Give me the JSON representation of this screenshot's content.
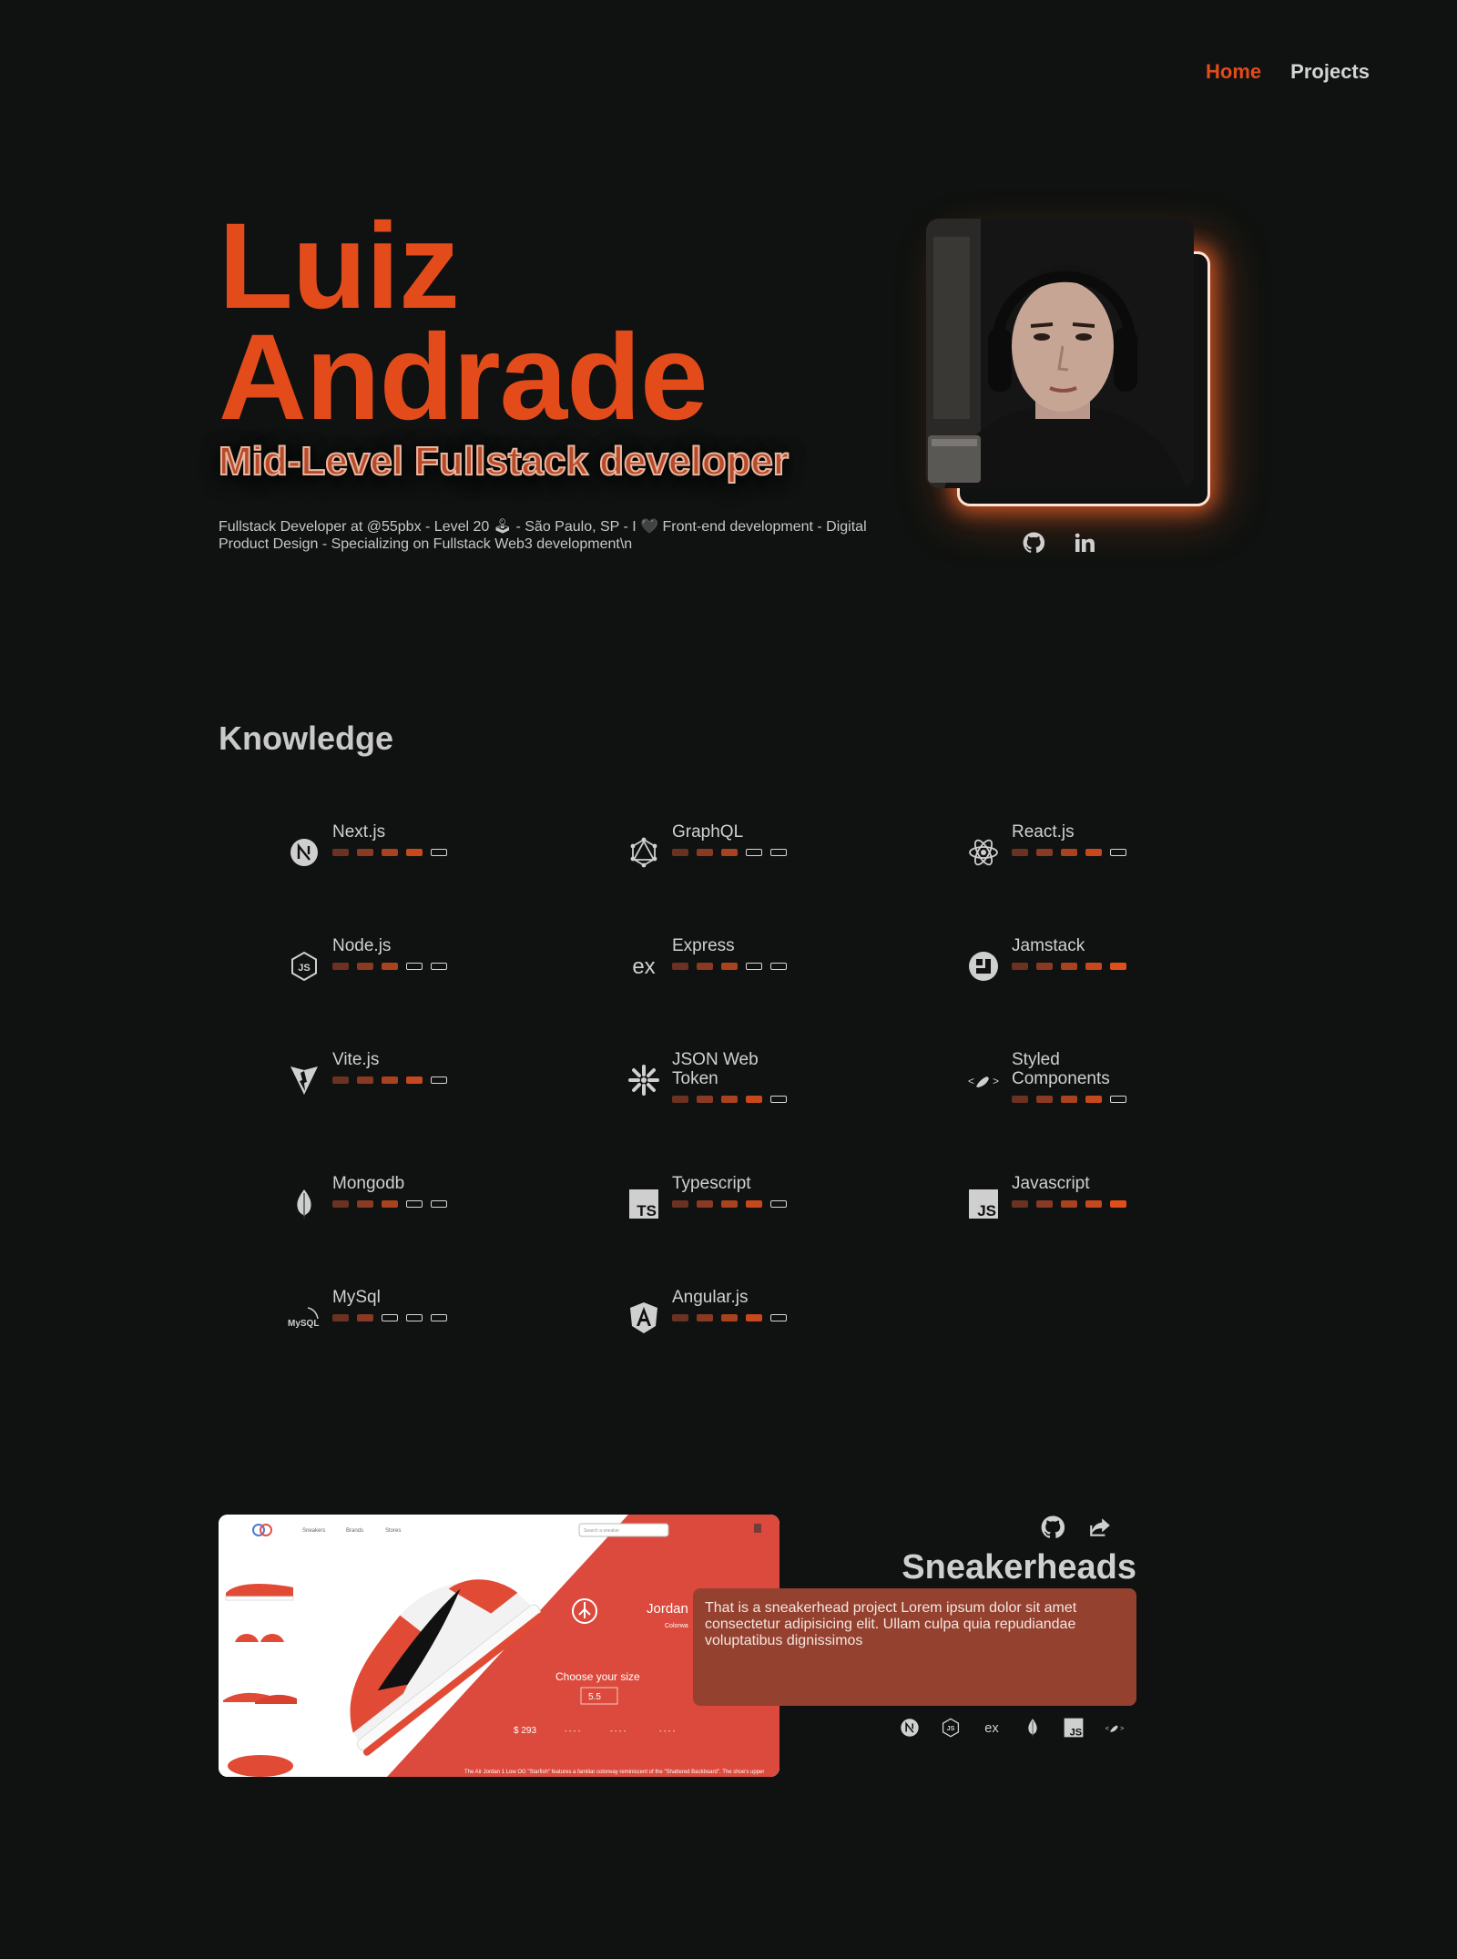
{
  "nav": {
    "home": "Home",
    "projects": "Projects"
  },
  "hero": {
    "first_name": "Luiz",
    "last_name": "Andrade",
    "role": "Mid-Level Fullstack developer",
    "bio": "Fullstack Developer at @55pbx - Level 20 🕹 - São Paulo, SP - I 🖤 Front-end development - Digital Product Design - Specializing on Fullstack Web3 development\\n"
  },
  "socials": [
    {
      "icon": "github-icon"
    },
    {
      "icon": "linkedin-icon"
    }
  ],
  "knowledge": {
    "title": "Knowledge",
    "skills": [
      {
        "name": "Next.js",
        "icon": "nextjs-icon",
        "level": 4
      },
      {
        "name": "GraphQL",
        "icon": "graphql-icon",
        "level": 3
      },
      {
        "name": "React.js",
        "icon": "react-icon",
        "level": 4
      },
      {
        "name": "Node.js",
        "icon": "nodejs-icon",
        "level": 3
      },
      {
        "name": "Express",
        "icon": "express-icon",
        "level": 3
      },
      {
        "name": "Jamstack",
        "icon": "jamstack-icon",
        "level": 5
      },
      {
        "name": "Vite.js",
        "icon": "vite-icon",
        "level": 4
      },
      {
        "name": "JSON Web Token",
        "icon": "jwt-icon",
        "level": 4
      },
      {
        "name": "Styled Components",
        "icon": "styled-components-icon",
        "level": 4
      },
      {
        "name": "Mongodb",
        "icon": "mongodb-icon",
        "level": 3
      },
      {
        "name": "Typescript",
        "icon": "typescript-icon",
        "level": 4
      },
      {
        "name": "Javascript",
        "icon": "javascript-icon",
        "level": 5
      },
      {
        "name": "MySql",
        "icon": "mysql-icon",
        "level": 2
      },
      {
        "name": "Angular.js",
        "icon": "angular-icon",
        "level": 4
      }
    ]
  },
  "project": {
    "title": "Sneakerheads",
    "description": "That is a sneakerhead project Lorem ipsum dolor sit amet consectetur adipisicing elit. Ullam culpa quia repudiandae voluptatibus dignissimos",
    "links": [
      {
        "icon": "github-icon"
      },
      {
        "icon": "share-icon"
      }
    ],
    "tech": [
      "nextjs-icon",
      "nodejs-icon",
      "express-icon",
      "mongodb-icon",
      "javascript-icon",
      "styled-components-icon"
    ],
    "screenshot": {
      "nav": [
        "Sneakers",
        "Brands",
        "Stores"
      ],
      "search_placeholder": "Search a sneaker",
      "product": "Jordan 1",
      "colorway": "Colorwa",
      "size_label": "Choose your size",
      "size": "5.5",
      "price": "$ 293",
      "footer": "The Air Jordan 1 Low OG \"Starfish\" features a familiar colorway reminiscent of the \"Shattered Backboard\". The shoe's upper"
    }
  }
}
